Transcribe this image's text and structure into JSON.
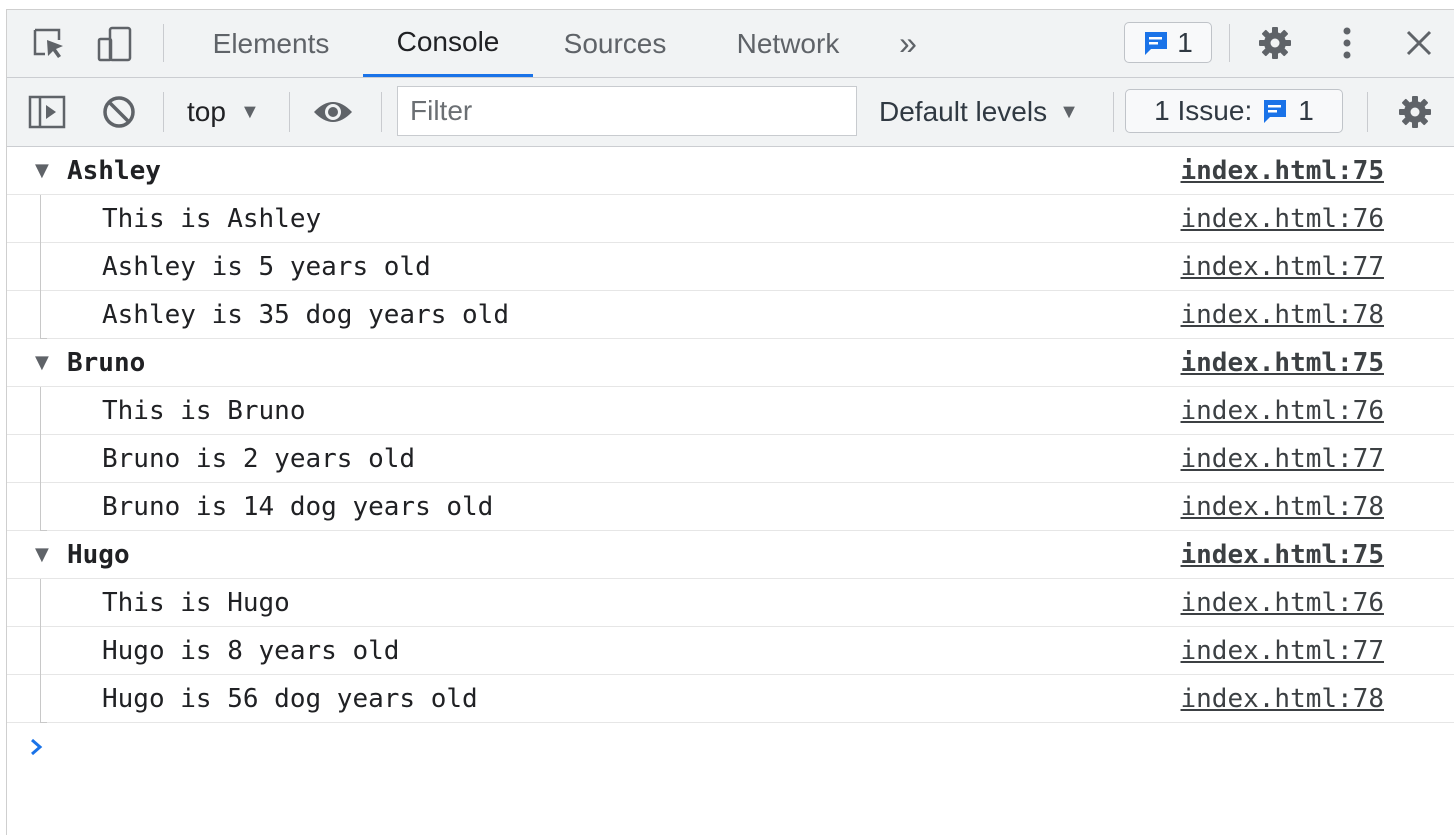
{
  "tabs": {
    "elements": "Elements",
    "console": "Console",
    "sources": "Sources",
    "network": "Network",
    "more": "»"
  },
  "message_badge": {
    "count": "1"
  },
  "toolbar": {
    "context": "top",
    "filter_placeholder": "Filter",
    "levels": "Default levels",
    "issues_label": "1 Issue:",
    "issues_count": "1"
  },
  "console": {
    "groups": [
      {
        "name": "Ashley",
        "source": "index.html:75",
        "messages": [
          {
            "text": "This is Ashley",
            "source": "index.html:76"
          },
          {
            "text": "Ashley is 5 years old",
            "source": "index.html:77"
          },
          {
            "text": "Ashley is 35 dog years old",
            "source": "index.html:78"
          }
        ]
      },
      {
        "name": "Bruno",
        "source": "index.html:75",
        "messages": [
          {
            "text": "This is Bruno",
            "source": "index.html:76"
          },
          {
            "text": "Bruno is 2 years old",
            "source": "index.html:77"
          },
          {
            "text": "Bruno is 14 dog years old",
            "source": "index.html:78"
          }
        ]
      },
      {
        "name": "Hugo",
        "source": "index.html:75",
        "messages": [
          {
            "text": "This is Hugo",
            "source": "index.html:76"
          },
          {
            "text": "Hugo is 8 years old",
            "source": "index.html:77"
          },
          {
            "text": "Hugo is 56 dog years old",
            "source": "index.html:78"
          }
        ]
      }
    ]
  },
  "colors": {
    "accent": "#1a73e8",
    "toolbar_bg": "#f1f3f4",
    "icon_gray": "#5f6368"
  }
}
